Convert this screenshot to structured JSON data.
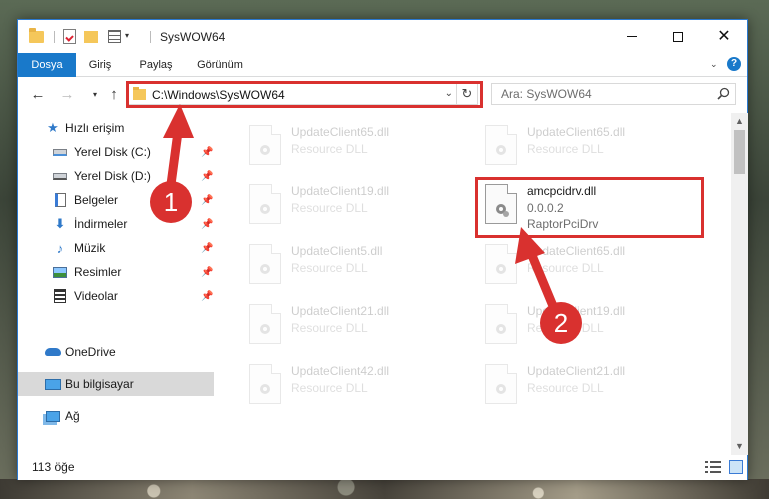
{
  "window": {
    "title": "SysWOW64",
    "minimize_label": "—",
    "maximize_label": "☐",
    "close_label": "✕"
  },
  "ribbon": {
    "tabs": [
      "Dosya",
      "Giriş",
      "Paylaş",
      "Görünüm"
    ],
    "expand_icon": "chevron-down-icon",
    "help_label": "?"
  },
  "nav": {
    "back_label": "←",
    "forward_label": "→",
    "recent_label": "▾",
    "up_label": "↑",
    "address": "C:\\Windows\\SysWOW64",
    "search_placeholder": "Ara: SysWOW64"
  },
  "sidebar": {
    "items": [
      {
        "label": "Hızlı erişim",
        "icon": "star-icon",
        "pinned": false
      },
      {
        "label": "Yerel Disk (C:)",
        "icon": "drive-icon",
        "pinned": true
      },
      {
        "label": "Yerel Disk (D:)",
        "icon": "drive-icon",
        "pinned": true
      },
      {
        "label": "Belgeler",
        "icon": "document-icon",
        "pinned": true
      },
      {
        "label": "İndirmeler",
        "icon": "download-icon",
        "pinned": true
      },
      {
        "label": "Müzik",
        "icon": "music-icon",
        "pinned": true
      },
      {
        "label": "Resimler",
        "icon": "pictures-icon",
        "pinned": true
      },
      {
        "label": "Videolar",
        "icon": "video-icon",
        "pinned": true
      },
      {
        "label": "OneDrive",
        "icon": "cloud-icon",
        "pinned": false
      },
      {
        "label": "Bu bilgisayar",
        "icon": "computer-icon",
        "pinned": false
      },
      {
        "label": "Ağ",
        "icon": "network-icon",
        "pinned": false
      }
    ]
  },
  "files": [
    {
      "name": "UpdateClient65.dll",
      "desc": "Resource DLL",
      "highlight": false
    },
    {
      "name": "UpdateClient65.dll",
      "desc": "Resource DLL",
      "highlight": false
    },
    {
      "name": "UpdateClient19.dll",
      "desc": "Resource DLL",
      "highlight": false
    },
    {
      "name": "amcpcidrv.dll",
      "desc": "0.0.0.2",
      "desc2": "RaptorPciDrv",
      "highlight": true
    },
    {
      "name": "UpdateClient5.dll",
      "desc": "Resource DLL",
      "highlight": false
    },
    {
      "name": "UpdateClient65.dll",
      "desc": "Resource DLL",
      "highlight": false
    },
    {
      "name": "UpdateClient21.dll",
      "desc": "Resource DLL",
      "highlight": false
    },
    {
      "name": "UpdateClient19.dll",
      "desc": "Resource DLL",
      "highlight": false
    },
    {
      "name": "UpdateClient42.dll",
      "desc": "Resource DLL",
      "highlight": false
    },
    {
      "name": "UpdateClient21.dll",
      "desc": "Resource DLL",
      "highlight": false
    }
  ],
  "status": {
    "item_count": "113 öğe"
  },
  "annotations": {
    "step1": "1",
    "step2": "2",
    "color": "#d9312f"
  }
}
